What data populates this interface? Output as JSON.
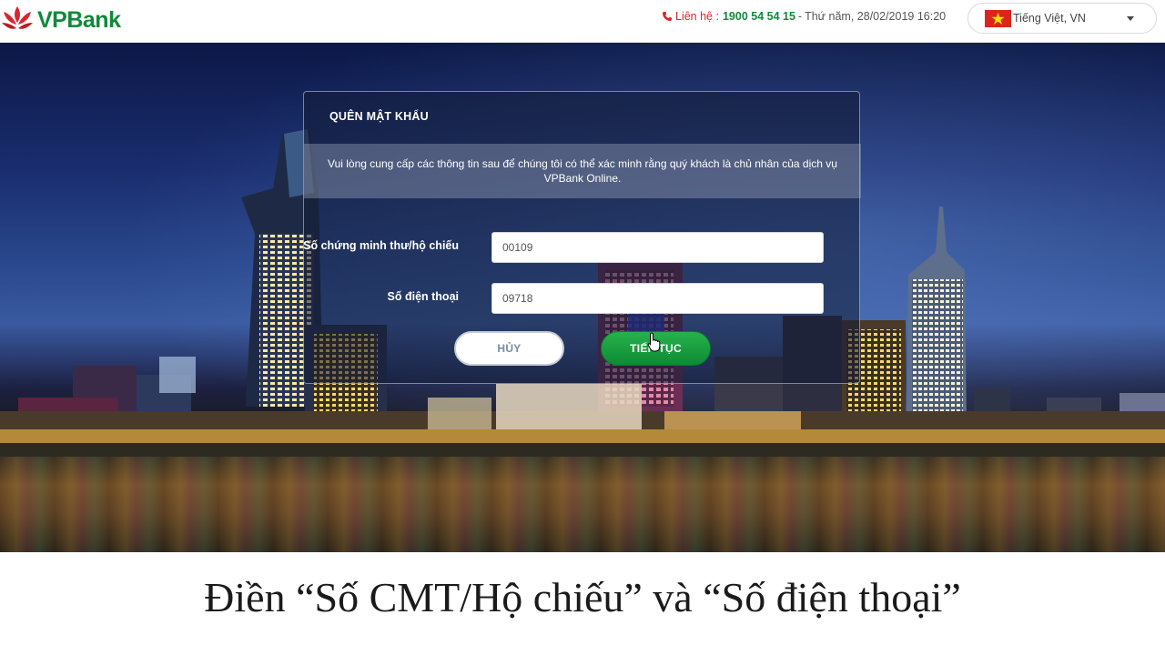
{
  "brand": {
    "name": "VPBank",
    "color": "#0f8a3b",
    "accent": "#e02424"
  },
  "header": {
    "contact_label": "Liên hệ :",
    "hotline": "1900 54 54 15",
    "separator": "-",
    "datetime": "Thứ năm, 28/02/2019 16:20",
    "language": "Tiếng Việt, VN"
  },
  "panel": {
    "title": "QUÊN MẬT KHẨU",
    "description": "Vui lòng cung cấp các thông tin sau để chúng tôi có thể xác minh rằng quý khách là chủ nhân của dịch vụ VPBank Online.",
    "fields": [
      {
        "label": "Số chứng minh thư/hộ chiếu",
        "value": "00109"
      },
      {
        "label": "Số điện thoại",
        "value": "09718"
      }
    ],
    "cancel_label": "HỦY",
    "continue_label": "TIẾP TỤC"
  },
  "caption": "Điền “Số CMT/Hộ chiếu” và “Số điện thoại”",
  "icons": [
    "vpbank-logo-icon",
    "phone-icon",
    "vietnam-flag-icon",
    "chevron-down-icon",
    "mouse-pointer-icon"
  ]
}
